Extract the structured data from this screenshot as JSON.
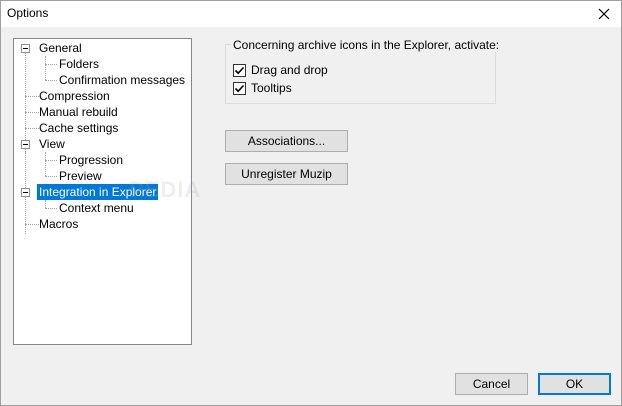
{
  "window": {
    "title": "Options"
  },
  "tree": {
    "items": [
      {
        "label": "General"
      },
      {
        "label": "Folders"
      },
      {
        "label": "Confirmation messages"
      },
      {
        "label": "Compression"
      },
      {
        "label": "Manual rebuild"
      },
      {
        "label": "Cache settings"
      },
      {
        "label": "View"
      },
      {
        "label": "Progression"
      },
      {
        "label": "Preview"
      },
      {
        "label": "Integration in Explorer",
        "selected": true
      },
      {
        "label": "Context menu"
      },
      {
        "label": "Macros"
      }
    ]
  },
  "explorer_group": {
    "label": "Concerning archive icons in the Explorer, activate:",
    "options": [
      {
        "label": "Drag and drop",
        "checked": true
      },
      {
        "label": "Tooltips",
        "checked": true
      }
    ]
  },
  "buttons": {
    "associations": "Associations...",
    "unregister": "Unregister Muzip",
    "cancel": "Cancel",
    "ok": "OK"
  },
  "watermark": "PEDIA",
  "colors": {
    "selection": "#0078d7",
    "window_bg": "#f0f0f0"
  }
}
